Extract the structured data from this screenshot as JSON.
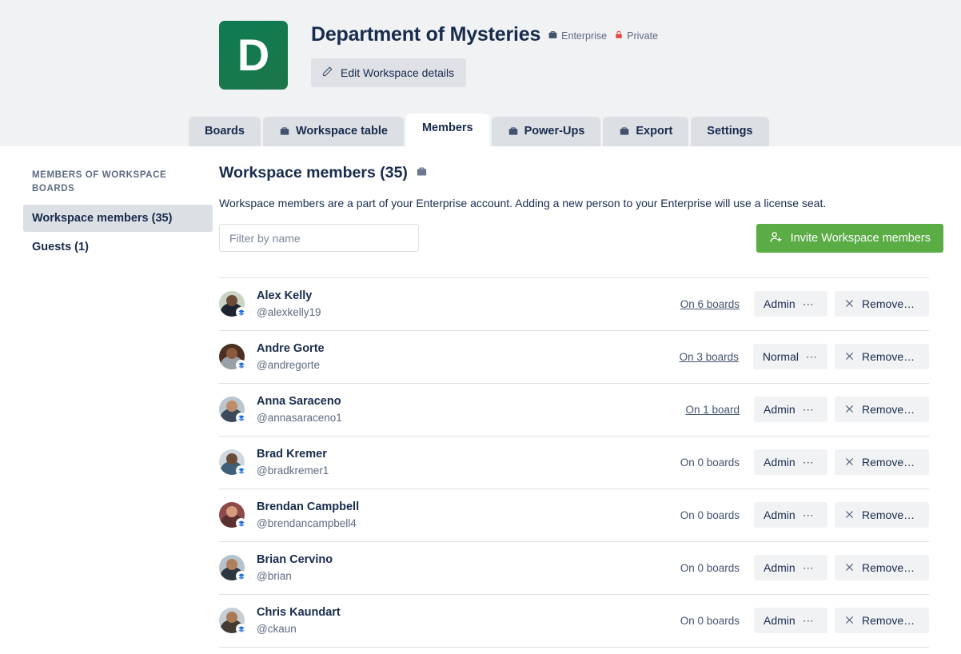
{
  "workspace": {
    "logo_letter": "D",
    "title": "Department of Mysteries",
    "enterprise_badge": "Enterprise",
    "visibility_badge": "Private",
    "edit_button": "Edit Workspace details"
  },
  "tabs": [
    {
      "label": "Boards",
      "icon": null,
      "active": false
    },
    {
      "label": "Workspace table",
      "icon": "briefcase-icon",
      "active": false
    },
    {
      "label": "Members",
      "icon": null,
      "active": true
    },
    {
      "label": "Power-Ups",
      "icon": "briefcase-icon",
      "active": false
    },
    {
      "label": "Export",
      "icon": "briefcase-icon",
      "active": false
    },
    {
      "label": "Settings",
      "icon": null,
      "active": false
    }
  ],
  "sidebar": {
    "heading": "MEMBERS OF WORKSPACE BOARDS",
    "items": [
      {
        "label": "Workspace members (35)",
        "active": true
      },
      {
        "label": "Guests (1)",
        "active": false
      }
    ]
  },
  "main": {
    "title": "Workspace members (35)",
    "description": "Workspace members are a part of your Enterprise account. Adding a new person to your Enterprise will use a license seat.",
    "filter_placeholder": "Filter by name",
    "filter_value": "",
    "invite_button": "Invite Workspace members"
  },
  "members": [
    {
      "name": "Alex Kelly",
      "handle": "@alexkelly19",
      "boards": "On 6 boards",
      "boards_is_link": true,
      "role": "Admin",
      "remove": "Remove…",
      "avatar": {
        "bg": "#c9d4c3",
        "head": "#6d4a3a",
        "body": "#1f2330"
      }
    },
    {
      "name": "Andre Gorte",
      "handle": "@andregorte",
      "boards": "On 3 boards",
      "boards_is_link": true,
      "role": "Normal",
      "remove": "Remove…",
      "avatar": {
        "bg": "#4a2f22",
        "head": "#8a5a3c",
        "body": "#9aa0a6"
      }
    },
    {
      "name": "Anna Saraceno",
      "handle": "@annasaraceno1",
      "boards": "On 1 board",
      "boards_is_link": true,
      "role": "Admin",
      "remove": "Remove…",
      "avatar": {
        "bg": "#b9c6cf",
        "head": "#c08b68",
        "body": "#3b4a5a"
      }
    },
    {
      "name": "Brad Kremer",
      "handle": "@bradkremer1",
      "boards": "On 0 boards",
      "boards_is_link": false,
      "role": "Admin",
      "remove": "Remove…",
      "avatar": {
        "bg": "#cfd8de",
        "head": "#6b4a37",
        "body": "#3f5f77"
      }
    },
    {
      "name": "Brendan Campbell",
      "handle": "@brendancampbell4",
      "boards": "On 0 boards",
      "boards_is_link": false,
      "role": "Admin",
      "remove": "Remove…",
      "avatar": {
        "bg": "#8e4a4a",
        "head": "#d79b7c",
        "body": "#5a3030"
      }
    },
    {
      "name": "Brian Cervino",
      "handle": "@brian",
      "boards": "On 0 boards",
      "boards_is_link": false,
      "role": "Admin",
      "remove": "Remove…",
      "avatar": {
        "bg": "#b7c3cc",
        "head": "#b07f5e",
        "body": "#2e3640"
      }
    },
    {
      "name": "Chris Kaundart",
      "handle": "@ckaun",
      "boards": "On 0 boards",
      "boards_is_link": false,
      "role": "Admin",
      "remove": "Remove…",
      "avatar": {
        "bg": "#c7cfd6",
        "head": "#a97a55",
        "body": "#433a33"
      }
    }
  ],
  "colors": {
    "header_bg": "#f1f2f4",
    "tab_bg": "#dcdfe4",
    "logo_green": "#0e7a51",
    "invite_green": "#5aac44",
    "text_navy": "#172b4d",
    "muted": "#5d6b82",
    "private_red": "#e2483d",
    "badge_blue": "#0052cc"
  }
}
